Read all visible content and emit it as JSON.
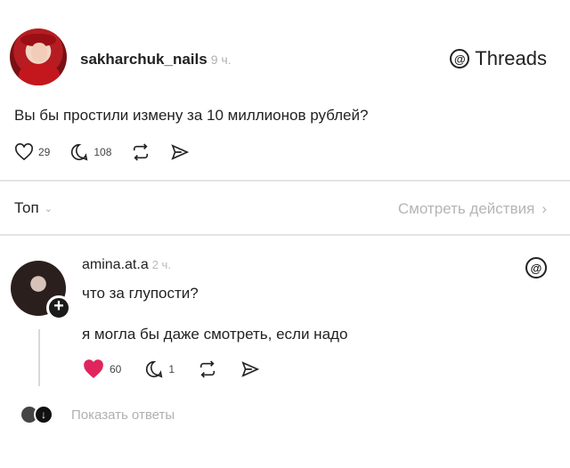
{
  "post": {
    "username": "sakharchuk_nails",
    "time": "9 ч.",
    "brand": "Threads",
    "brand_mark": "@",
    "text": "Вы бы простили измену за 10 миллионов рублей?",
    "likes": "29",
    "comments": "108",
    "icons": [
      "heart-icon",
      "comment-icon",
      "repost-icon",
      "share-icon"
    ]
  },
  "sort": {
    "label": "Топ",
    "chevron": "⌄",
    "view_actions": "Смотреть действия",
    "view_actions_chevron": "›"
  },
  "reply": {
    "username": "amina.at.a",
    "time": "2 ч.",
    "text1": "что за глупости?",
    "text2": "я могла бы даже смотреть, если надо",
    "likes": "60",
    "comments": "1",
    "liked_color": "#e0245e",
    "plus": "+"
  },
  "replies": {
    "label": "Показать ответы",
    "mini_badge": "↓"
  }
}
